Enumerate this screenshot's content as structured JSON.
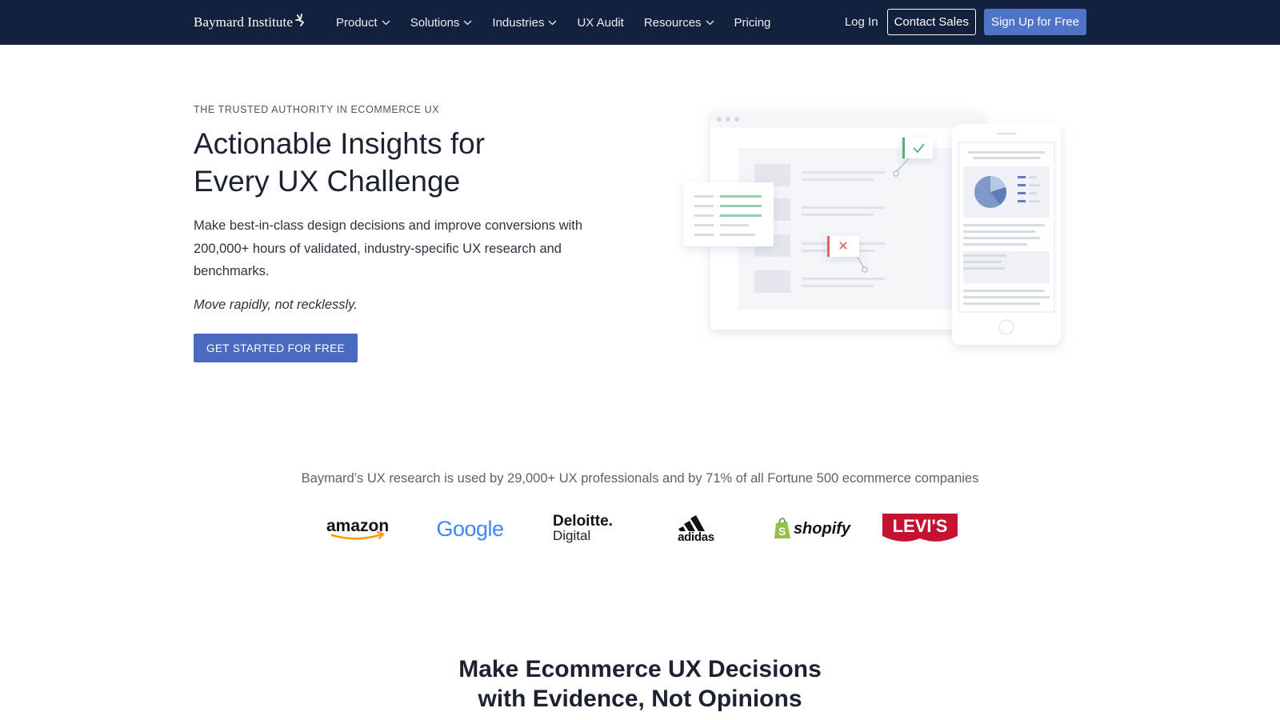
{
  "nav": {
    "logo_text": "Baymard Institute",
    "items": [
      {
        "label": "Product",
        "has_dropdown": true
      },
      {
        "label": "Solutions",
        "has_dropdown": true
      },
      {
        "label": "Industries",
        "has_dropdown": true
      },
      {
        "label": "UX Audit",
        "has_dropdown": false
      },
      {
        "label": "Resources",
        "has_dropdown": true
      },
      {
        "label": "Pricing",
        "has_dropdown": false
      }
    ],
    "login_label": "Log In",
    "contact_label": "Contact Sales",
    "signup_label": "Sign Up for Free",
    "colors": {
      "background": "#13213c",
      "signup": "#4e73c7"
    }
  },
  "hero": {
    "eyebrow": "THE TRUSTED AUTHORITY IN ECOMMERCE UX",
    "title_line1": "Actionable Insights for",
    "title_line2": "Every UX Challenge",
    "description": "Make best-in-class design decisions and improve conversions with 200,000+ hours of validated, industry-specific UX research and benchmarks.",
    "tagline": "Move rapidly, not recklessly.",
    "cta_label": "GET STARTED FOR FREE",
    "cta_color": "#4a6bbd"
  },
  "trust": {
    "text": "Baymard’s UX research is used by 29,000+ UX professionals and by 71% of all Fortune 500 ecommerce companies",
    "logos": [
      {
        "name": "amazon-logo",
        "text": "amazon"
      },
      {
        "name": "google-logo",
        "text": "Google"
      },
      {
        "name": "deloitte-digital-logo",
        "text": "Deloitte.",
        "subtext": "Digital"
      },
      {
        "name": "adidas-logo",
        "text": "adidas"
      },
      {
        "name": "shopify-logo",
        "text": "shopify"
      },
      {
        "name": "levis-logo",
        "text": "LEVI'S"
      }
    ]
  },
  "section": {
    "title_line1": "Make Ecommerce UX Decisions",
    "title_line2": "with Evidence, Not Opinions"
  }
}
